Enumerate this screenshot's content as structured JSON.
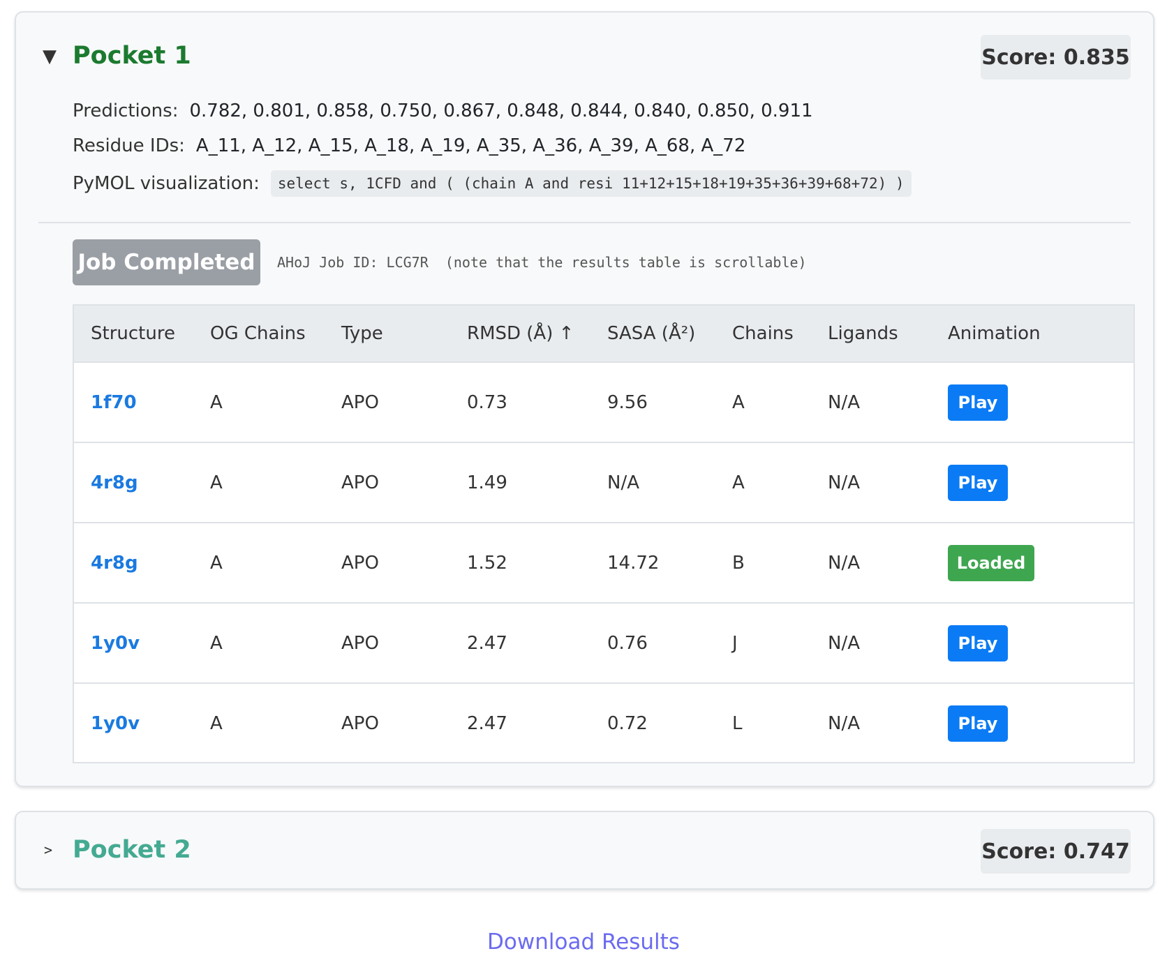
{
  "pockets": [
    {
      "title": "Pocket 1",
      "expanded": true,
      "toggle_icon": "▼",
      "score": "Score: 0.835",
      "predictions_label": "Predictions:",
      "predictions": "0.782, 0.801, 0.858, 0.750, 0.867, 0.848, 0.844, 0.840, 0.850, 0.911",
      "residues_label": "Residue IDs:",
      "residues": "A_11, A_12, A_15, A_18, A_19, A_35, A_36, A_39, A_68, A_72",
      "pymol_label": "PyMOL visualization:",
      "pymol_command": "select s, 1CFD and ( (chain A and resi 11+12+15+18+19+35+36+39+68+72) )",
      "job_status": "Job Completed",
      "job_info": "AHoJ Job ID: LCG7R  (note that the results table is scrollable)",
      "table": {
        "headers": [
          "Structure",
          "OG Chains",
          "Type",
          "RMSD (Å) ↑",
          "SASA (Å²)",
          "Chains",
          "Ligands",
          "Animation"
        ],
        "rows": [
          {
            "structure": "1f70",
            "og_chains": "A",
            "type": "APO",
            "rmsd": "0.73",
            "sasa": "9.56",
            "chains": "A",
            "ligands": "N/A",
            "animation": "Play",
            "animation_state": "play"
          },
          {
            "structure": "4r8g",
            "og_chains": "A",
            "type": "APO",
            "rmsd": "1.49",
            "sasa": "N/A",
            "chains": "A",
            "ligands": "N/A",
            "animation": "Play",
            "animation_state": "play"
          },
          {
            "structure": "4r8g",
            "og_chains": "A",
            "type": "APO",
            "rmsd": "1.52",
            "sasa": "14.72",
            "chains": "B",
            "ligands": "N/A",
            "animation": "Loaded",
            "animation_state": "loaded"
          },
          {
            "structure": "1y0v",
            "og_chains": "A",
            "type": "APO",
            "rmsd": "2.47",
            "sasa": "0.76",
            "chains": "J",
            "ligands": "N/A",
            "animation": "Play",
            "animation_state": "play"
          },
          {
            "structure": "1y0v",
            "og_chains": "A",
            "type": "APO",
            "rmsd": "2.47",
            "sasa": "0.72",
            "chains": "L",
            "ligands": "N/A",
            "animation": "Play",
            "animation_state": "play"
          }
        ]
      }
    },
    {
      "title": "Pocket 2",
      "expanded": false,
      "toggle_icon": ">",
      "score": "Score: 0.747"
    }
  ],
  "download_label": "Download Results",
  "colors": {
    "pocket1_title": "#1b7a2f",
    "pocket2_title": "#44aa92",
    "link": "#1a7ae0",
    "play_button": "#0a7bf5",
    "loaded_button": "#3fa650",
    "job_completed_button": "#9a9fa5",
    "download_link": "#6b6bf0"
  }
}
